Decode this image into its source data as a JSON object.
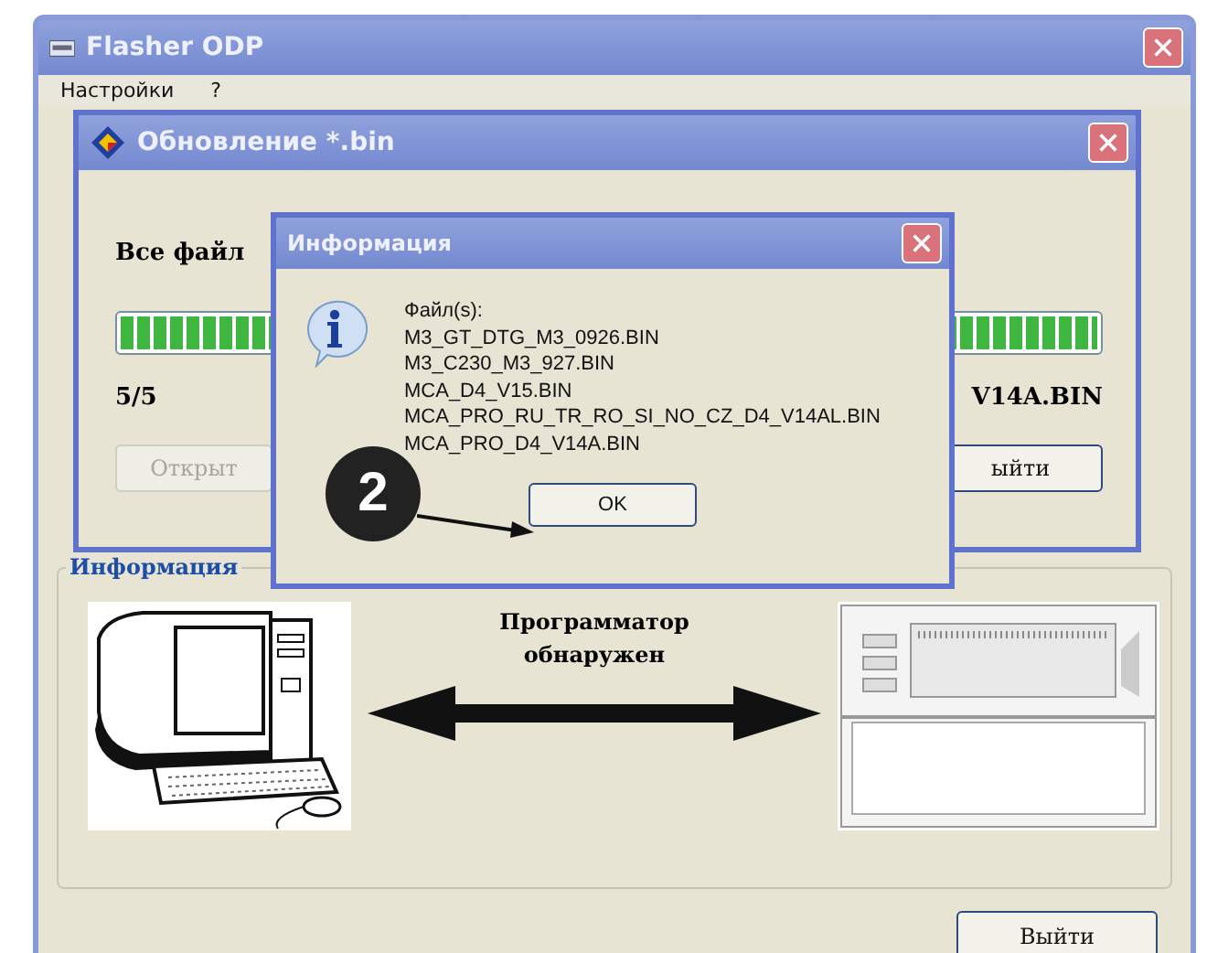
{
  "main_window": {
    "title": "Flasher ODP",
    "menu": [
      "Настройки",
      "?"
    ],
    "group": {
      "title": "Информация",
      "status": "Программатор обнаружен"
    },
    "buttons": [
      "Выйти"
    ]
  },
  "update_window": {
    "title": "Обновление *.bin",
    "heading": "Все файл",
    "progress": {
      "level": 1
    },
    "count": "5/5",
    "file": "V14A.BIN",
    "buttons": [
      {
        "label": "Открыт",
        "disabled": true
      },
      {
        "label": "ыйти",
        "disabled": false
      }
    ]
  },
  "info_dialog": {
    "title": "Информация",
    "lines": [
      "Файл(s):",
      "M3_GT_DTG_M3_0926.BIN",
      "M3_C230_M3_927.BIN",
      "MCA_D4_V15.BIN",
      "MCA_PRO_RU_TR_RO_SI_NO_CZ_D4_V14AL.BIN",
      "MCA_PRO_D4_V14A.BIN"
    ],
    "button": "OK"
  },
  "callout": {
    "label": "2"
  }
}
